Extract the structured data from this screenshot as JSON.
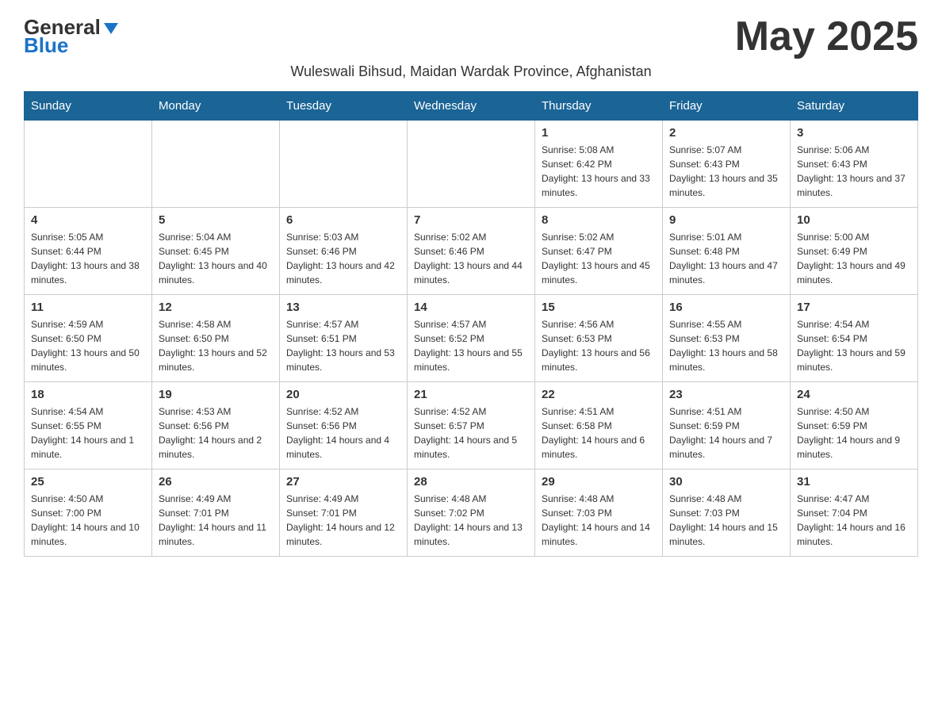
{
  "header": {
    "logo_general": "General",
    "logo_blue": "Blue",
    "month_title": "May 2025",
    "subtitle": "Wuleswali Bihsud, Maidan Wardak Province, Afghanistan"
  },
  "days_of_week": [
    "Sunday",
    "Monday",
    "Tuesday",
    "Wednesday",
    "Thursday",
    "Friday",
    "Saturday"
  ],
  "weeks": [
    [
      {
        "day": "",
        "info": ""
      },
      {
        "day": "",
        "info": ""
      },
      {
        "day": "",
        "info": ""
      },
      {
        "day": "",
        "info": ""
      },
      {
        "day": "1",
        "info": "Sunrise: 5:08 AM\nSunset: 6:42 PM\nDaylight: 13 hours and 33 minutes."
      },
      {
        "day": "2",
        "info": "Sunrise: 5:07 AM\nSunset: 6:43 PM\nDaylight: 13 hours and 35 minutes."
      },
      {
        "day": "3",
        "info": "Sunrise: 5:06 AM\nSunset: 6:43 PM\nDaylight: 13 hours and 37 minutes."
      }
    ],
    [
      {
        "day": "4",
        "info": "Sunrise: 5:05 AM\nSunset: 6:44 PM\nDaylight: 13 hours and 38 minutes."
      },
      {
        "day": "5",
        "info": "Sunrise: 5:04 AM\nSunset: 6:45 PM\nDaylight: 13 hours and 40 minutes."
      },
      {
        "day": "6",
        "info": "Sunrise: 5:03 AM\nSunset: 6:46 PM\nDaylight: 13 hours and 42 minutes."
      },
      {
        "day": "7",
        "info": "Sunrise: 5:02 AM\nSunset: 6:46 PM\nDaylight: 13 hours and 44 minutes."
      },
      {
        "day": "8",
        "info": "Sunrise: 5:02 AM\nSunset: 6:47 PM\nDaylight: 13 hours and 45 minutes."
      },
      {
        "day": "9",
        "info": "Sunrise: 5:01 AM\nSunset: 6:48 PM\nDaylight: 13 hours and 47 minutes."
      },
      {
        "day": "10",
        "info": "Sunrise: 5:00 AM\nSunset: 6:49 PM\nDaylight: 13 hours and 49 minutes."
      }
    ],
    [
      {
        "day": "11",
        "info": "Sunrise: 4:59 AM\nSunset: 6:50 PM\nDaylight: 13 hours and 50 minutes."
      },
      {
        "day": "12",
        "info": "Sunrise: 4:58 AM\nSunset: 6:50 PM\nDaylight: 13 hours and 52 minutes."
      },
      {
        "day": "13",
        "info": "Sunrise: 4:57 AM\nSunset: 6:51 PM\nDaylight: 13 hours and 53 minutes."
      },
      {
        "day": "14",
        "info": "Sunrise: 4:57 AM\nSunset: 6:52 PM\nDaylight: 13 hours and 55 minutes."
      },
      {
        "day": "15",
        "info": "Sunrise: 4:56 AM\nSunset: 6:53 PM\nDaylight: 13 hours and 56 minutes."
      },
      {
        "day": "16",
        "info": "Sunrise: 4:55 AM\nSunset: 6:53 PM\nDaylight: 13 hours and 58 minutes."
      },
      {
        "day": "17",
        "info": "Sunrise: 4:54 AM\nSunset: 6:54 PM\nDaylight: 13 hours and 59 minutes."
      }
    ],
    [
      {
        "day": "18",
        "info": "Sunrise: 4:54 AM\nSunset: 6:55 PM\nDaylight: 14 hours and 1 minute."
      },
      {
        "day": "19",
        "info": "Sunrise: 4:53 AM\nSunset: 6:56 PM\nDaylight: 14 hours and 2 minutes."
      },
      {
        "day": "20",
        "info": "Sunrise: 4:52 AM\nSunset: 6:56 PM\nDaylight: 14 hours and 4 minutes."
      },
      {
        "day": "21",
        "info": "Sunrise: 4:52 AM\nSunset: 6:57 PM\nDaylight: 14 hours and 5 minutes."
      },
      {
        "day": "22",
        "info": "Sunrise: 4:51 AM\nSunset: 6:58 PM\nDaylight: 14 hours and 6 minutes."
      },
      {
        "day": "23",
        "info": "Sunrise: 4:51 AM\nSunset: 6:59 PM\nDaylight: 14 hours and 7 minutes."
      },
      {
        "day": "24",
        "info": "Sunrise: 4:50 AM\nSunset: 6:59 PM\nDaylight: 14 hours and 9 minutes."
      }
    ],
    [
      {
        "day": "25",
        "info": "Sunrise: 4:50 AM\nSunset: 7:00 PM\nDaylight: 14 hours and 10 minutes."
      },
      {
        "day": "26",
        "info": "Sunrise: 4:49 AM\nSunset: 7:01 PM\nDaylight: 14 hours and 11 minutes."
      },
      {
        "day": "27",
        "info": "Sunrise: 4:49 AM\nSunset: 7:01 PM\nDaylight: 14 hours and 12 minutes."
      },
      {
        "day": "28",
        "info": "Sunrise: 4:48 AM\nSunset: 7:02 PM\nDaylight: 14 hours and 13 minutes."
      },
      {
        "day": "29",
        "info": "Sunrise: 4:48 AM\nSunset: 7:03 PM\nDaylight: 14 hours and 14 minutes."
      },
      {
        "day": "30",
        "info": "Sunrise: 4:48 AM\nSunset: 7:03 PM\nDaylight: 14 hours and 15 minutes."
      },
      {
        "day": "31",
        "info": "Sunrise: 4:47 AM\nSunset: 7:04 PM\nDaylight: 14 hours and 16 minutes."
      }
    ]
  ]
}
